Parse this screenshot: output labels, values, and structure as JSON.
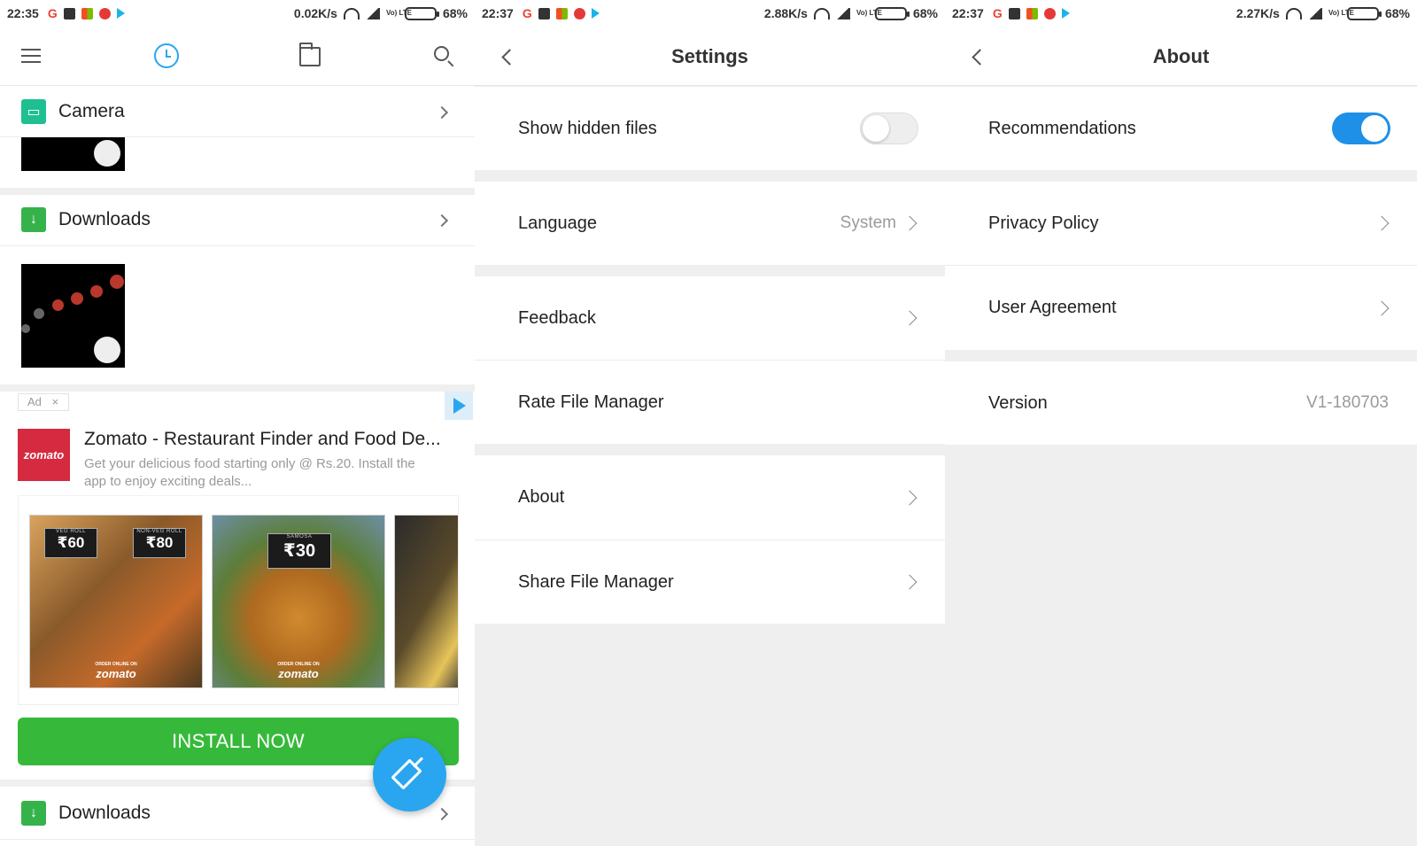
{
  "colors": {
    "accent": "#2aa6f0",
    "install_green": "#36b93a",
    "toggle_on": "#1e90e8",
    "zomato_red": "#d52a3f"
  },
  "screens": [
    {
      "status": {
        "time": "22:35",
        "speed": "0.02K/s",
        "battery": "68%",
        "volte": "Vo) LTE"
      },
      "toolbar": {
        "icons": [
          "menu-icon",
          "history-clock-icon",
          "folder-icon",
          "search-icon"
        ]
      },
      "sections": [
        {
          "title": "Camera",
          "icon": "gallery-icon"
        },
        {
          "title": "Downloads",
          "icon": "download-arrow-icon"
        },
        {
          "title": "Downloads",
          "icon": "download-arrow-icon"
        }
      ],
      "ad": {
        "tag": "Ad",
        "close": "×",
        "logo_text": "zomato",
        "title": "Zomato - Restaurant Finder and Food De...",
        "description": "Get your delicious food starting only @ Rs.20. Install the app to enjoy exciting deals...",
        "images": [
          {
            "tags": [
              {
                "name": "VEG ROLL",
                "price": "₹60"
              },
              {
                "name": "NON-VEG ROLL",
                "price": "₹80"
              }
            ],
            "small": "ORDER ONLINE ON",
            "brand": "zomato"
          },
          {
            "tags": [
              {
                "name": "SAMOSA",
                "price": "₹30"
              }
            ],
            "small": "ORDER ONLINE ON",
            "brand": "zomato"
          }
        ],
        "install_label": "INSTALL NOW"
      }
    },
    {
      "status": {
        "time": "22:37",
        "speed": "2.88K/s",
        "battery": "68%",
        "volte": "Vo) LTE"
      },
      "title": "Settings",
      "rows": {
        "show_hidden": {
          "label": "Show hidden files",
          "toggle": false
        },
        "language": {
          "label": "Language",
          "value": "System"
        },
        "feedback": {
          "label": "Feedback"
        },
        "rate": {
          "label": "Rate File Manager"
        },
        "about": {
          "label": "About"
        },
        "share": {
          "label": "Share File Manager"
        }
      }
    },
    {
      "status": {
        "time": "22:37",
        "speed": "2.27K/s",
        "battery": "68%",
        "volte": "Vo) LTE"
      },
      "title": "About",
      "rows": {
        "recommendations": {
          "label": "Recommendations",
          "toggle": true
        },
        "privacy": {
          "label": "Privacy Policy"
        },
        "agreement": {
          "label": "User Agreement"
        },
        "version": {
          "label": "Version",
          "value": "V1-180703"
        }
      }
    }
  ]
}
